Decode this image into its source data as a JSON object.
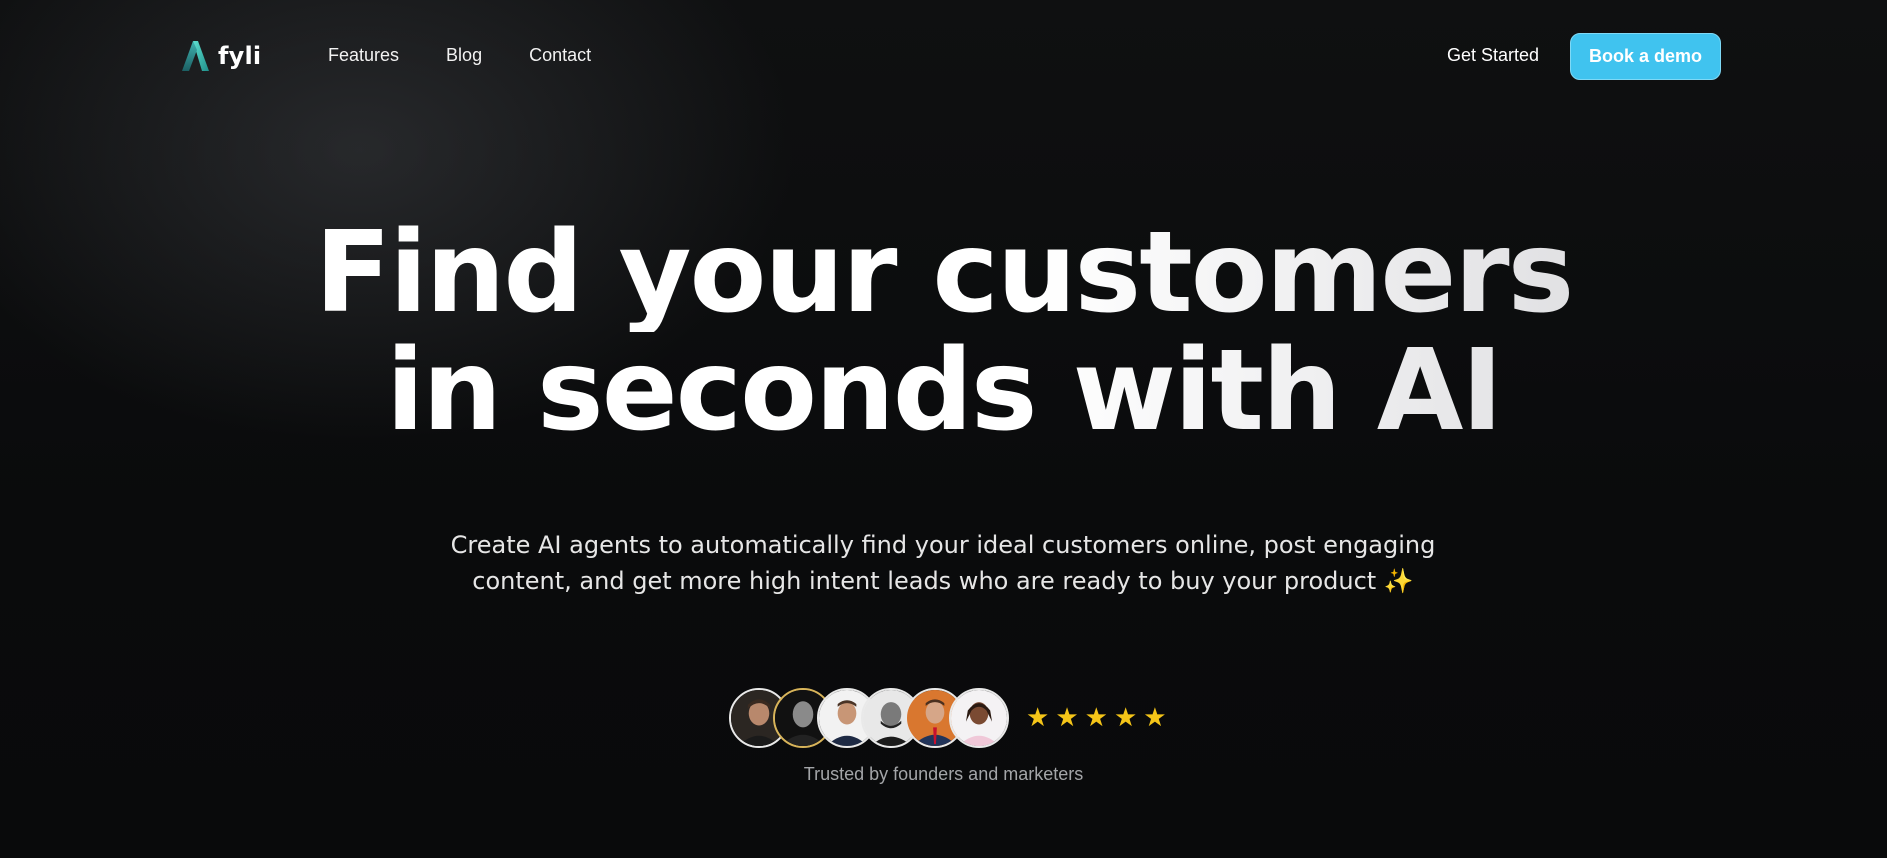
{
  "brand": {
    "name": "fyli",
    "logo_icon": "fyli-logo-icon",
    "accent_color": "#40c3ef"
  },
  "nav": {
    "links": [
      {
        "label": "Features"
      },
      {
        "label": "Blog"
      },
      {
        "label": "Contact"
      }
    ],
    "get_started_label": "Get Started",
    "demo_button_label": "Book a demo"
  },
  "hero": {
    "headline_line1": "Find your customers",
    "headline_line2": "in seconds with AI",
    "subtitle": "Create AI agents to automatically find your ideal customers online, post engaging content, and get more high intent leads who are ready to buy your product ✨"
  },
  "social_proof": {
    "avatar_count": 6,
    "rating_stars": 5,
    "star_color": "#f5c518",
    "caption": "Trusted by founders and marketers"
  }
}
